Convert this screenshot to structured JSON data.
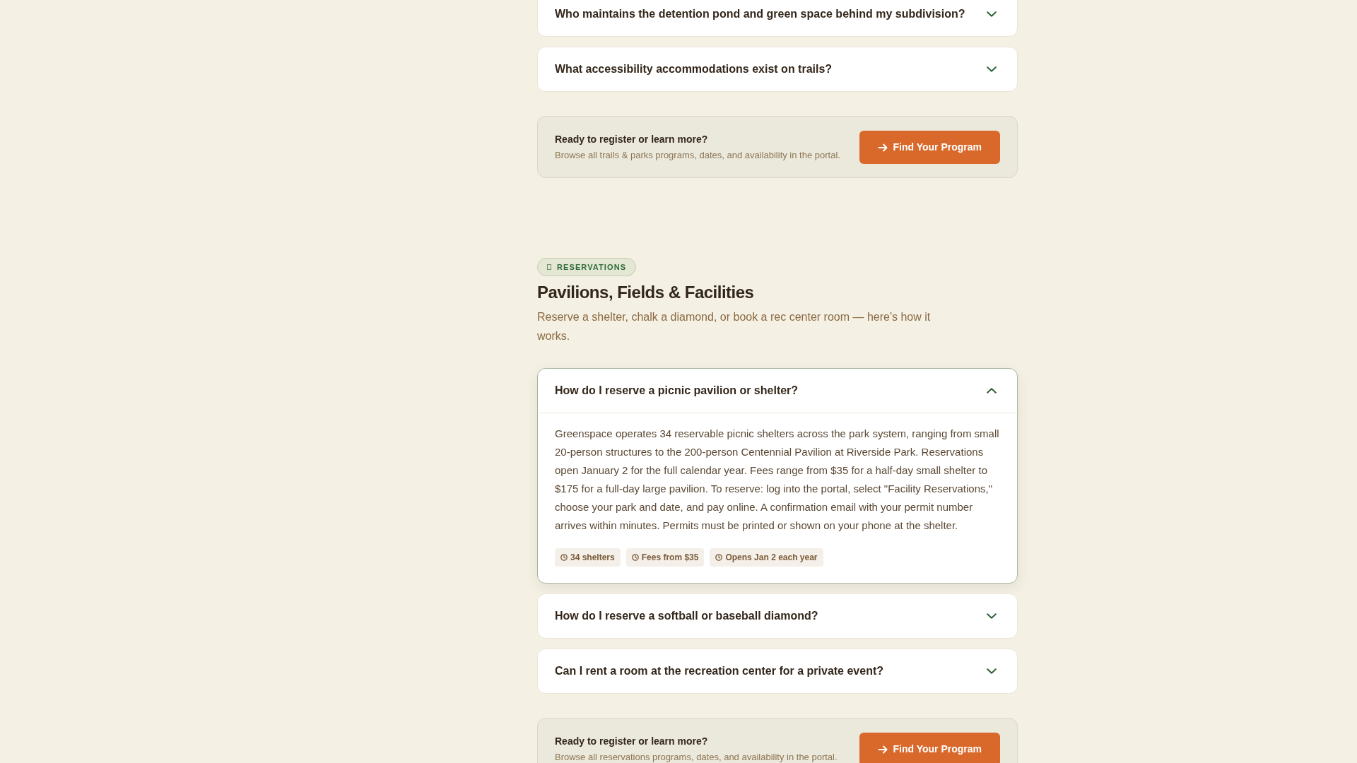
{
  "sections": [
    {
      "faqs": [
        {
          "question": "Who maintains the detention pond and green space behind my subdivision?",
          "expanded": false
        },
        {
          "question": "What accessibility accommodations exist on trails?",
          "expanded": false
        }
      ],
      "cta": {
        "title": "Ready to register or learn more?",
        "text": "Browse all trails & parks programs, dates, and availability in the portal.",
        "button": "Find Your Program"
      }
    },
    {
      "badge": "RESERVATIONS",
      "title": "Pavilions, Fields & Facilities",
      "subtitle": "Reserve a shelter, chalk a diamond, or book a rec center room — here's how it works.",
      "faqs": [
        {
          "question": "How do I reserve a picnic pavilion or shelter?",
          "expanded": true,
          "answer": "Greenspace operates 34 reservable picnic shelters across the park system, ranging from small 20-person structures to the 200-person Centennial Pavilion at Riverside Park. Reservations open January 2 for the full calendar year. Fees range from $35 for a half-day small shelter to $175 for a full-day large pavilion. To reserve: log into the portal, select \"Facility Reservations,\" choose your park and date, and pay online. A confirmation email with your permit number arrives within minutes. Permits must be printed or shown on your phone at the shelter.",
          "tags": [
            "34 shelters",
            "Fees from $35",
            "Opens Jan 2 each year"
          ]
        },
        {
          "question": "How do I reserve a softball or baseball diamond?",
          "expanded": false
        },
        {
          "question": "Can I rent a room at the recreation center for a private event?",
          "expanded": false
        }
      ],
      "cta": {
        "title": "Ready to register or learn more?",
        "text": "Browse all reservations programs, dates, and availability in the portal.",
        "button": "Find Your Program"
      }
    }
  ]
}
